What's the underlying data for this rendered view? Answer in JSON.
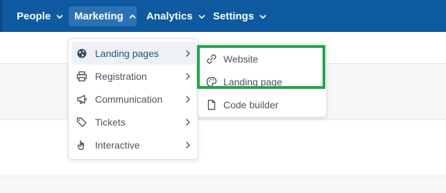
{
  "nav": {
    "items": [
      {
        "label": "People"
      },
      {
        "label": "Marketing"
      },
      {
        "label": "Analytics"
      },
      {
        "label": "Settings"
      }
    ]
  },
  "menu": {
    "items": [
      {
        "label": "Landing pages",
        "icon": "globe-icon"
      },
      {
        "label": "Registration",
        "icon": "printer-icon"
      },
      {
        "label": "Communication",
        "icon": "megaphone-icon"
      },
      {
        "label": "Tickets",
        "icon": "tags-icon"
      },
      {
        "label": "Interactive",
        "icon": "pointer-hand-icon"
      }
    ]
  },
  "submenu": {
    "items": [
      {
        "label": "Website",
        "icon": "link-icon"
      },
      {
        "label": "Landing page",
        "icon": "palette-icon"
      },
      {
        "label": "Code builder",
        "icon": "file-icon"
      }
    ]
  },
  "colors": {
    "nav_bg": "#0d5aa0",
    "nav_active": "#2a72b4",
    "highlight_box": "#1fa64a"
  }
}
